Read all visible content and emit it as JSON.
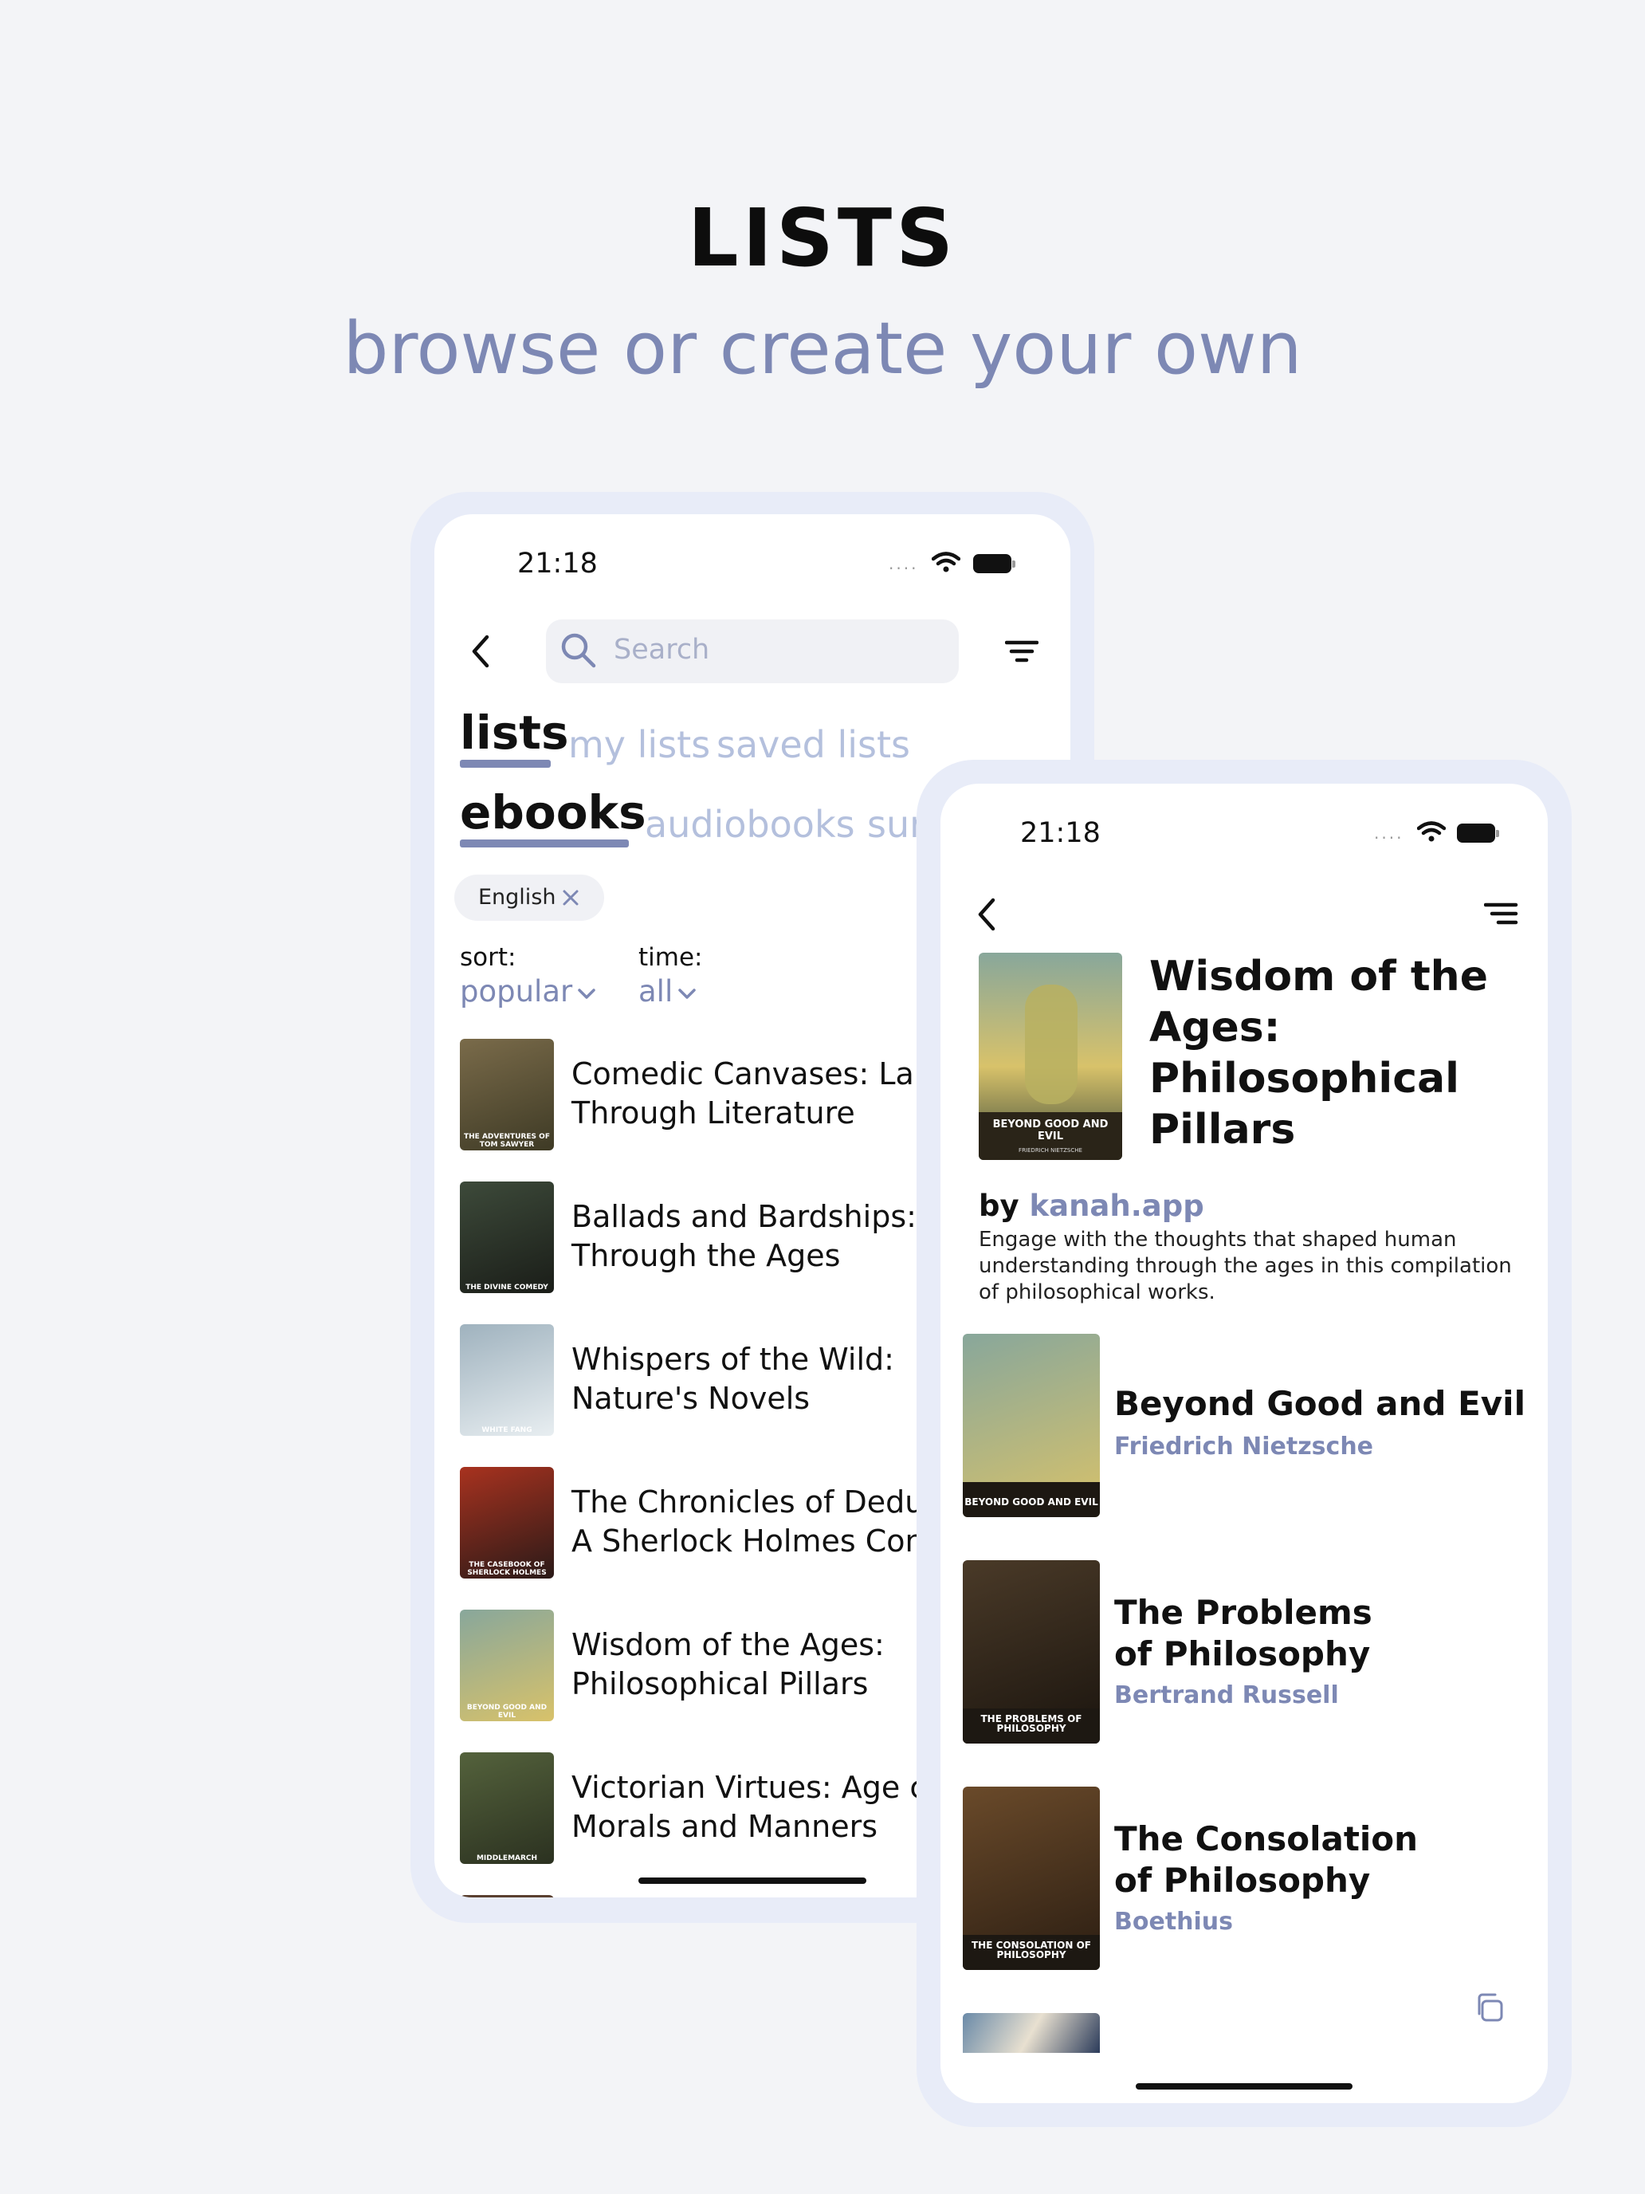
{
  "hero": {
    "title": "LISTS",
    "subtitle": "browse or create your own"
  },
  "phone1": {
    "status": {
      "time": "21:18",
      "signal": "...."
    },
    "search": {
      "placeholder": "Search"
    },
    "tabs_primary": {
      "active": "lists",
      "others": [
        "my lists",
        "saved lists"
      ]
    },
    "tabs_secondary": {
      "active": "ebooks",
      "others": [
        "audiobooks",
        "sur"
      ]
    },
    "filter_chip": {
      "label": "English"
    },
    "sort": {
      "label": "sort:",
      "value": "popular"
    },
    "time_filter": {
      "label": "time:",
      "value": "all"
    },
    "lists": [
      {
        "title": "Comedic Canvases: Lau\nThrough Literature",
        "cover_caption": "THE ADVENTURES OF TOM SAWYER",
        "cover_colors": [
          "#7a6b4a",
          "#3e3a25"
        ]
      },
      {
        "title": "Ballads and Bardships:\nThrough the Ages",
        "cover_caption": "THE DIVINE COMEDY",
        "cover_colors": [
          "#3d4a3a",
          "#1a1d18"
        ]
      },
      {
        "title": "Whispers of the Wild:\nNature's Novels",
        "cover_caption": "WHITE FANG",
        "cover_colors": [
          "#9fb2be",
          "#e8eef1"
        ]
      },
      {
        "title": "The Chronicles of Dedu\nA Sherlock Holmes Con",
        "cover_caption": "THE CASEBOOK OF SHERLOCK HOLMES",
        "cover_colors": [
          "#a8321f",
          "#2a1a18"
        ]
      },
      {
        "title": "Wisdom of the Ages:\nPhilosophical Pillars",
        "cover_caption": "BEYOND GOOD AND EVIL",
        "cover_colors": [
          "#88a79b",
          "#d8c26a"
        ]
      },
      {
        "title": "Victorian Virtues: Age c\nMorals and Manners",
        "cover_caption": "MIDDLEMARCH",
        "cover_colors": [
          "#54623c",
          "#2b3120"
        ]
      }
    ]
  },
  "phone2": {
    "status": {
      "time": "21:18",
      "signal": "...."
    },
    "title": "Wisdom of the Ages: Philosophical Pillars",
    "header_cover_caption": "BEYOND GOOD AND EVIL",
    "header_cover_author": "FRIEDRICH NIETZSCHE",
    "by_label": "by",
    "author_link": "kanah.app",
    "description": "Engage with the thoughts that shaped human understanding through the ages in this compilation of philosophical works.",
    "books": [
      {
        "title": "Beyond Good and Evil",
        "author": "Friedrich Nietzsche",
        "cover_caption": "BEYOND GOOD AND EVIL",
        "cover_colors": [
          "#88a79b",
          "#d8c26a"
        ]
      },
      {
        "title": "The Problems\nof Philosophy",
        "author": "Bertrand Russell",
        "cover_caption": "THE PROBLEMS OF PHILOSOPHY",
        "cover_colors": [
          "#4a3a28",
          "#1a140e"
        ]
      },
      {
        "title": "The Consolation\nof Philosophy",
        "author": "Boethius",
        "cover_caption": "THE CONSOLATION OF PHILOSOPHY",
        "cover_colors": [
          "#6a4a2a",
          "#2a1d12"
        ]
      }
    ]
  }
}
